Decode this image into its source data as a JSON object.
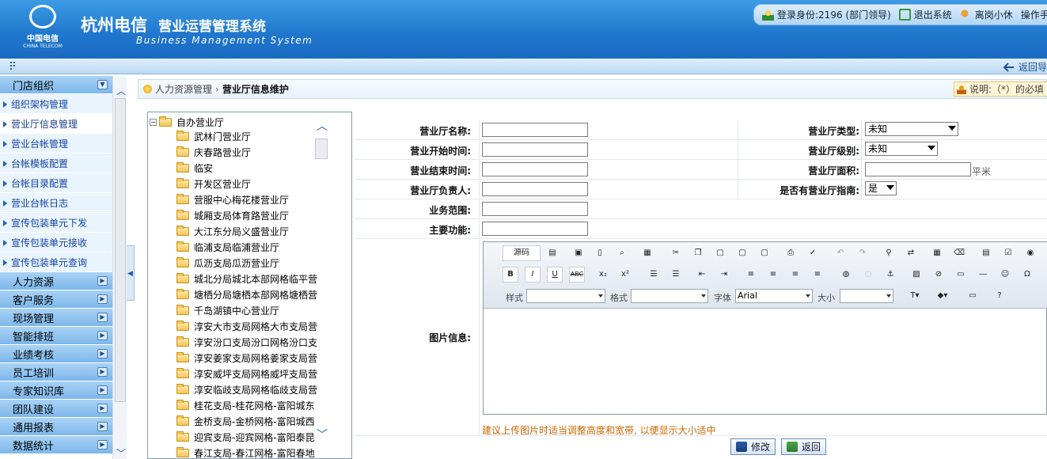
{
  "header": {
    "company": "杭州电信",
    "system": "营业运营管理系统",
    "system_en": "Business Management System",
    "logo_cn": "中国电信",
    "logo_en": "CHINA TELECOM",
    "login_info": "登录身份:2196 (部门领导)",
    "logout": "退出系统",
    "away": "离岗小休",
    "manual": "操作手"
  },
  "toolbar": {
    "back": "返回导"
  },
  "sidebar": {
    "sections": [
      {
        "label": "门店组织",
        "expanded": true
      },
      {
        "label": "人力资源"
      },
      {
        "label": "客户服务"
      },
      {
        "label": "现场管理"
      },
      {
        "label": "智能排班"
      },
      {
        "label": "业绩考核"
      },
      {
        "label": "员工培训"
      },
      {
        "label": "专家知识库"
      },
      {
        "label": "团队建设"
      },
      {
        "label": "通用报表"
      },
      {
        "label": "数据统计"
      }
    ],
    "items": [
      {
        "label": "组织架构管理"
      },
      {
        "label": "营业厅信息管理",
        "active": true
      },
      {
        "label": "营业台帐管理"
      },
      {
        "label": "台帐模板配置"
      },
      {
        "label": "台帐目录配置"
      },
      {
        "label": "营业台帐日志"
      },
      {
        "label": "宣传包装单元下发"
      },
      {
        "label": "宣传包装单元接收"
      },
      {
        "label": "宣传包装单元查询"
      }
    ]
  },
  "breadcrumb": {
    "parent": "人力资源管理",
    "current": "营业厅信息维护"
  },
  "note": "说明:（*）的必填",
  "tree": {
    "root": "自办营业厅",
    "nodes": [
      "武林门营业厅",
      "庆春路营业厅",
      "临安",
      "开发区营业厅",
      "营服中心梅花楼营业厅",
      "城厢支局体育路营业厅",
      "大江东分局义盛营业厅",
      "临浦支局临浦营业厅",
      "瓜沥支局瓜沥营业厅",
      "城北分局城北本部网格临平营",
      "塘栖分局塘栖本部网格塘栖营",
      "千岛湖镇中心营业厅",
      "淳安大市支局网格大市支局营",
      "淳安汾口支局汾口网格汾口支",
      "淳安姜家支局网格姜家支局营",
      "淳安威坪支局网格威坪支局营",
      "淳安临歧支局网格临歧支局营",
      "桂花支局-桂花网格-富阳城东",
      "金桥支局-金桥网格-富阳城西",
      "迎宾支局-迎宾网格-富阳泰昆",
      "春江支局-春江网格-富阳春地"
    ]
  },
  "form": {
    "name_label": "营业厅名称:",
    "type_label": "营业厅类型:",
    "type_value": "未知",
    "start_label": "营业开始时间:",
    "level_label": "营业厅级别:",
    "level_value": "未知",
    "end_label": "营业结束时间:",
    "area_label": "营业厅面积:",
    "area_unit": "平米",
    "owner_label": "营业厅负责人:",
    "guide_label": "是否有营业厅指南:",
    "guide_value": "是",
    "scope_label": "业务范围:",
    "func_label": "主要功能:",
    "image_label": "图片信息:"
  },
  "editor": {
    "source": "源码",
    "style_label": "样式",
    "format_label": "格式",
    "font_label": "字体",
    "font_value": "Arial",
    "size_label": "大小"
  },
  "hint": "建议上传图片时适当调整高度和宽带, 以便显示大小适中",
  "actions": {
    "save": "修改",
    "back": "返回"
  }
}
